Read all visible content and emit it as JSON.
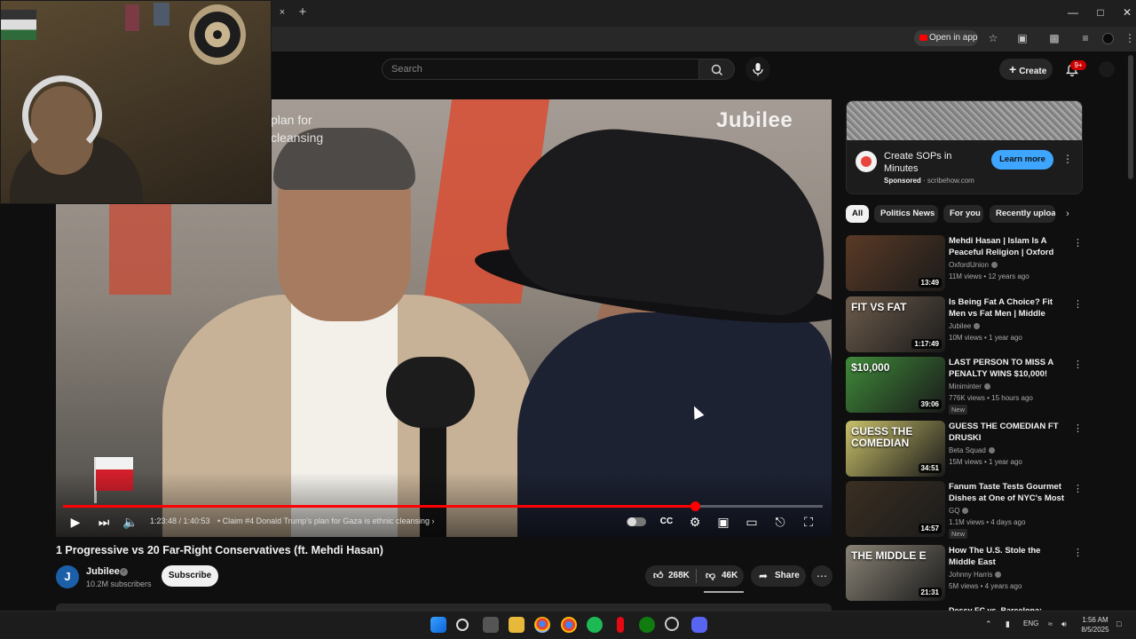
{
  "browser": {
    "open_in_app_label": "Open in app",
    "tab_close_icon": "×",
    "new_tab_icon": "+"
  },
  "header": {
    "search_placeholder": "Search",
    "create_label": "Create",
    "notification_count": "9+"
  },
  "player": {
    "overlay_text_line1": "plan for",
    "overlay_text_line2": "cleansing",
    "brand_watermark": "Jubilee",
    "time_display": "1:23:48 / 1:40:53",
    "chapter_label": "•  Claim #4 Donald Trump's plan for Gaza is ethnic cleansing  ›",
    "progress_fraction": 0.832
  },
  "video": {
    "title": "1 Progressive vs 20 Far-Right Conservatives (ft. Mehdi Hasan)",
    "channel_initial": "J",
    "channel_name": "Jubilee",
    "channel_subscribers": "10.2M subscribers",
    "subscribe_label": "Subscribe",
    "likes": "268K",
    "dislikes": "46K",
    "share_label": "Share"
  },
  "ad": {
    "title": "Create SOPs in Minutes",
    "sponsored_label": "Sponsored",
    "sponsored_domain": "· scribehow.com",
    "cta_label": "Learn more"
  },
  "chips": [
    {
      "label": "All",
      "active": true
    },
    {
      "label": "Politics News",
      "active": false
    },
    {
      "label": "For you",
      "active": false
    },
    {
      "label": "Recently uploaded",
      "active": false
    }
  ],
  "recommendations": [
    {
      "title": "Mehdi Hasan | Islam Is A Peaceful Religion | Oxford Union",
      "channel": "OxfordUnion",
      "meta": "11M views • 12 years ago",
      "duration": "13:49",
      "new": "",
      "color": "#5a3a26"
    },
    {
      "title": "Is Being Fat A Choice? Fit Men vs Fat Men | Middle Ground",
      "channel": "Jubilee",
      "meta": "10M views • 1 year ago",
      "duration": "1:17:49",
      "new": "",
      "color": "#6d5c4c",
      "thumb_text": "FIT VS FAT"
    },
    {
      "title": "LAST PERSON TO MISS A PENALTY WINS $10,000!",
      "channel": "Miniminter",
      "meta": "776K views • 15 hours ago",
      "duration": "39:06",
      "new": "New",
      "color": "#3f8a39",
      "thumb_text": "$10,000"
    },
    {
      "title": "GUESS THE COMEDIAN FT DRUSKI",
      "channel": "Beta Squad",
      "meta": "15M views • 1 year ago",
      "duration": "34:51",
      "new": "",
      "color": "#c9c06a",
      "thumb_text": "GUESS THE COMEDIAN"
    },
    {
      "title": "Fanum Taste Tests Gourmet Dishes at One of NYC's Most ...",
      "channel": "GQ",
      "meta": "1.1M views • 4 days ago",
      "duration": "14:57",
      "new": "New",
      "color": "#3b2f22"
    },
    {
      "title": "How The U.S. Stole the Middle East",
      "channel": "Johnny Harris",
      "meta": "5M views • 4 years ago",
      "duration": "21:31",
      "new": "",
      "color": "#8a8376",
      "thumb_text": "THE MIDDLE E"
    }
  ],
  "partial_next_title": "Dessy FC vs. Barcelona:",
  "taskbar": {
    "language": "ENG",
    "time": "1:56 AM",
    "date": "8/5/2025"
  },
  "colors": {
    "background": "#0f0f0f",
    "accent_red": "#ff0000",
    "ad_button_blue": "#3ea6ff"
  }
}
